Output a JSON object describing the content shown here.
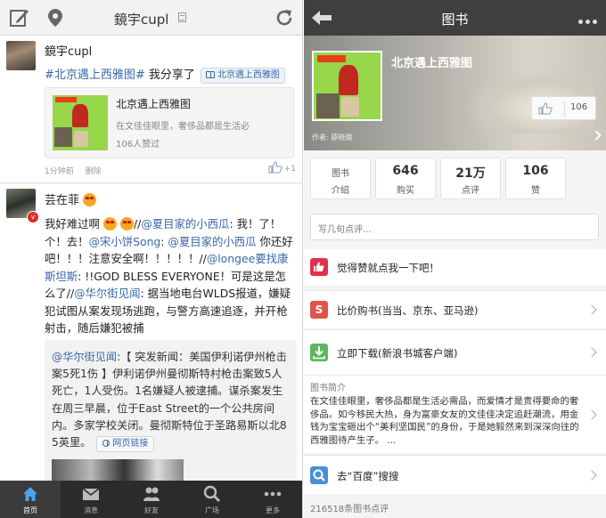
{
  "left": {
    "header": {
      "title": "鏡宇cupl"
    },
    "post1": {
      "username": "鏡宇cupl",
      "hashtag": "#北京遇上西雅图#",
      "text": " 我分享了",
      "chip": "北京遇上西雅图",
      "card": {
        "title": "北京遇上西雅图",
        "summary": "在文佳佳眼里，奢侈品都是生活必",
        "likes": "106人赞过"
      },
      "time": "1分钟前",
      "delete": "删除",
      "like_count": "+1"
    },
    "post2": {
      "username": "芸在菲",
      "body": {
        "p1": "我好难过啊",
        "p2": "//",
        "m1": "@夏目家的小西瓜",
        "p3": ": 我！了！个！去！",
        "m2": "@宋小饼Song",
        "p4": ": ",
        "m3": "@夏目家的小西瓜",
        "p5": " 你还好吧！！！注意安全啊！！！！！//",
        "m4": "@longee要找康斯坦斯",
        "p6": ": !!GOD BLESS EVERYONE！可是这是怎么了//",
        "m5": "@华尔街见闻",
        "p7": ": 据当地电台WLDS报道，嫌疑犯试图从案发现场逃跑，与警方高速追逐，并开枪射击，随后嫌犯被捕"
      },
      "quote": {
        "mention": "@华尔街见闻",
        "text": ":【 突发新闻：美国伊利诺伊州枪击案5死1伤 】伊利诺伊州曼彻斯特村枪击案致5人死亡，1人受伤。1名嫌疑人被逮捕。谋杀案发生在周三早晨，位于East Street的一个公共房间内。多家学校关闭。曼彻斯特位于圣路易斯以北85英里。",
        "web_chip": "网页链接"
      }
    },
    "tabbar": [
      {
        "label": "首页",
        "icon": "home-icon"
      },
      {
        "label": "消息",
        "icon": "mail-icon"
      },
      {
        "label": "好友",
        "icon": "friends-icon"
      },
      {
        "label": "广场",
        "icon": "search-icon"
      },
      {
        "label": "更多",
        "icon": "more-icon"
      }
    ]
  },
  "right": {
    "header": {
      "title": "图书"
    },
    "banner": {
      "title": "北京遇上西雅图",
      "author": "作者: 薛晓璐",
      "like_count": "106"
    },
    "stats": [
      {
        "value": "图书",
        "label": "介绍"
      },
      {
        "value": "646",
        "label": "购买"
      },
      {
        "value": "21万",
        "label": "点评"
      },
      {
        "value": "106",
        "label": "赞"
      }
    ],
    "comment_placeholder": "写几句点评...",
    "rows": {
      "like": "觉得赞就点我一下吧！",
      "compare": "比价购书(当当、京东、亚马逊)",
      "download": "立即下载(新浪书城客户端)",
      "intro_heading": "图书简介",
      "intro_text": "在文佳佳眼里，奢侈品都是生活必需品，而爱情才是贵得要命的奢侈品。如今移民大热，身为富豪女友的文佳佳决定追赶潮流，用金钱为宝宝砸出个“美利坚国民”的身份，于是她毅然来到深深向往的西雅图待产生子。 ...",
      "search": "去“百度”搜搜"
    },
    "footer": "216518条图书点评"
  },
  "colors": {
    "link": "#3a68a8",
    "like_red": "#e0324a",
    "price_red": "#e0554a",
    "download_green": "#5cb85c",
    "search_blue": "#4a8fd8",
    "right_header": "#3f3f3f"
  }
}
